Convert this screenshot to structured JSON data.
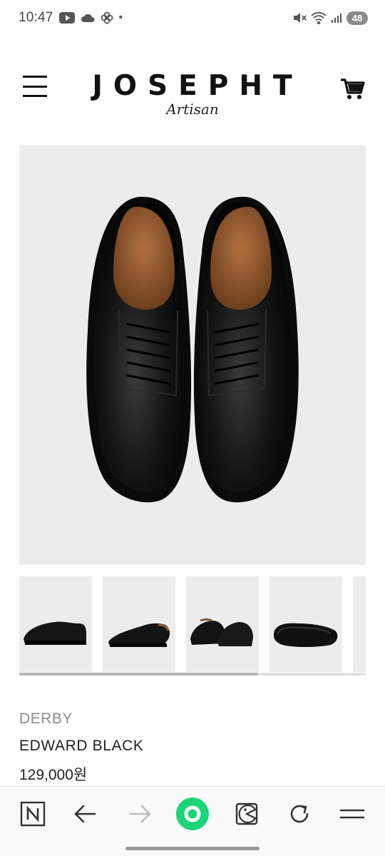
{
  "status_bar": {
    "time": "10:47",
    "dot": "•",
    "battery": "48",
    "icons": [
      "youtube-icon",
      "cloud-icon",
      "pinwheel-icon",
      "mute-icon",
      "wifi-icon",
      "signal-icon"
    ]
  },
  "header": {
    "brand": "JOSEPHT",
    "brand_sub": "Artisan",
    "icons": [
      "hamburger-menu-icon",
      "shopping-cart-icon"
    ]
  },
  "gallery": {
    "main_image": "black derby shoes top view",
    "thumbnails": [
      "derby side view",
      "derby three-quarter view",
      "derby pair angled view",
      "derby sole view",
      "partial next thumbnail"
    ],
    "scroll_progress": 0.69
  },
  "product": {
    "category": "DERBY",
    "name": "EDWARD BLACK",
    "price": "129,000원"
  },
  "browser_nav": {
    "buttons": [
      "naver-n-icon",
      "back-arrow-icon",
      "forward-arrow-icon",
      "green-home-icon",
      "pacman-icon",
      "refresh-icon",
      "menu-icon"
    ]
  },
  "colors": {
    "accent_green": "#1ed47a",
    "image_bg": "#ececec",
    "category_gray": "#8d8d8d"
  }
}
